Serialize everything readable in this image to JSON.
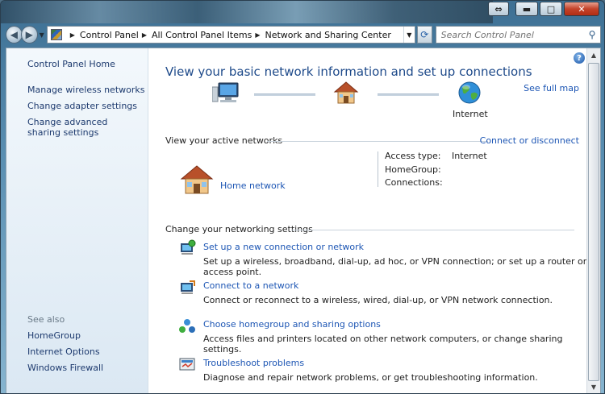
{
  "window": {
    "caption": {
      "restore_glyph": "⇔",
      "minimize_glyph": "▬",
      "maximize_glyph": "□",
      "close_glyph": "✕"
    }
  },
  "nav": {
    "back_glyph": "◀",
    "forward_glyph": "▶",
    "breadcrumbs": [
      "Control Panel",
      "All Control Panel Items",
      "Network and Sharing Center"
    ],
    "refresh_glyph": "⟳"
  },
  "search": {
    "placeholder": "Search Control Panel",
    "icon": "search-icon"
  },
  "sidebar": {
    "items": [
      {
        "label": "Control Panel Home"
      },
      {
        "label": "Manage wireless networks"
      },
      {
        "label": "Change adapter settings"
      },
      {
        "label": "Change advanced sharing settings"
      }
    ],
    "see_also_heading": "See also",
    "see_also": [
      {
        "label": "HomeGroup"
      },
      {
        "label": "Internet Options"
      },
      {
        "label": "Windows Firewall"
      }
    ]
  },
  "main": {
    "title": "View your basic network information and set up connections",
    "see_full_map": "See full map",
    "map": {
      "nodes": [
        {
          "icon": "computer-icon",
          "label": ""
        },
        {
          "icon": "house-icon",
          "label": ""
        },
        {
          "icon": "globe-icon",
          "label": "Internet"
        }
      ]
    },
    "active_networks": {
      "heading": "View your active networks",
      "connect_link": "Connect or disconnect",
      "network_name": "Home network",
      "info": [
        {
          "label": "Access type:",
          "value": "Internet"
        },
        {
          "label": "HomeGroup:",
          "value": ""
        },
        {
          "label": "Connections:",
          "value": ""
        }
      ]
    },
    "settings": {
      "heading": "Change your networking settings",
      "tasks": [
        {
          "title": "Set up a new connection or network",
          "description": "Set up a wireless, broadband, dial-up, ad hoc, or VPN connection; or set up a router or access point."
        },
        {
          "title": "Connect to a network",
          "description": "Connect or reconnect to a wireless, wired, dial-up, or VPN network connection."
        },
        {
          "title": "Choose homegroup and sharing options",
          "description": "Access files and printers located on other network computers, or change sharing settings."
        },
        {
          "title": "Troubleshoot problems",
          "description": "Diagnose and repair network problems, or get troubleshooting information."
        }
      ]
    }
  },
  "colors": {
    "link": "#1d56b4",
    "title": "#1e4a8a",
    "sidebar_link": "#1d3a6e"
  }
}
